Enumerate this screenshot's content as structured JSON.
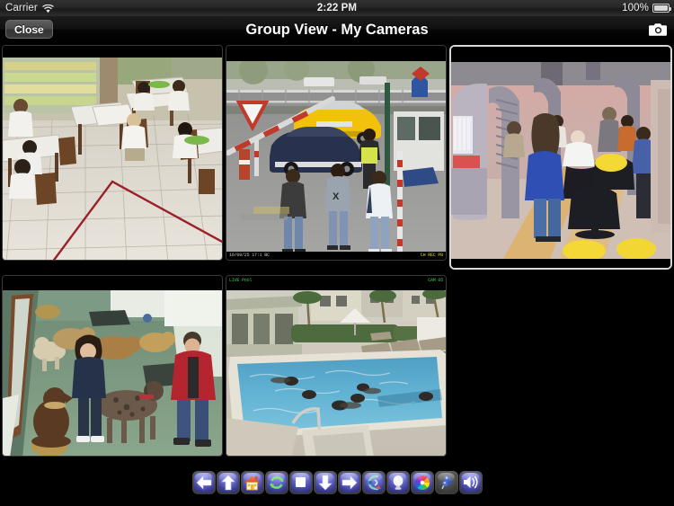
{
  "statusbar": {
    "carrier": "Carrier",
    "wifi_icon": "wifi-icon",
    "time": "2:22 PM",
    "battery_percent": "100%",
    "battery_icon": "battery-full-icon"
  },
  "titlebar": {
    "close_label": "Close",
    "title": "Group View - My Cameras",
    "camera_icon": "camera-icon"
  },
  "grid": {
    "tiles": [
      {
        "id": "tile-1",
        "name": "camera-tile-1",
        "scene": "classroom-cafeteria",
        "selected": false,
        "osd_bottom_left": "",
        "osd_bottom_right": ""
      },
      {
        "id": "tile-2",
        "name": "camera-tile-2",
        "scene": "parking-gate-entrance",
        "selected": false,
        "osd_bottom_left": "10/09/25  17:1  BC",
        "osd_bottom_right": "CH  REC  PB"
      },
      {
        "id": "tile-3",
        "name": "camera-tile-3",
        "scene": "hair-salon-interior",
        "selected": true,
        "osd_bottom_left": "",
        "osd_bottom_right": ""
      },
      {
        "id": "tile-4",
        "name": "camera-tile-4",
        "scene": "dog-daycare",
        "selected": false,
        "osd_bottom_left": "",
        "osd_bottom_right": ""
      },
      {
        "id": "tile-5",
        "name": "camera-tile-5",
        "scene": "swimming-pool",
        "selected": false,
        "osd_top_left": "LIVE  Pool",
        "osd_top_right": "CAM 05"
      }
    ]
  },
  "toolbar": {
    "buttons": [
      {
        "name": "pan-left-button",
        "icon": "arrow-left-icon",
        "label": "Pan Left"
      },
      {
        "name": "tilt-up-button",
        "icon": "arrow-up-icon",
        "label": "Tilt Up"
      },
      {
        "name": "home-preset-button",
        "icon": "home-icon",
        "label": "Home"
      },
      {
        "name": "auto-scan-button",
        "icon": "refresh-icon",
        "label": "Auto Scan"
      },
      {
        "name": "stop-button",
        "icon": "stop-square-icon",
        "label": "Stop"
      },
      {
        "name": "tilt-down-button",
        "icon": "arrow-down-icon",
        "label": "Tilt Down"
      },
      {
        "name": "pan-right-button",
        "icon": "arrow-right-icon",
        "label": "Pan Right"
      },
      {
        "name": "pattern-tour-button",
        "icon": "pattern-path-icon",
        "label": "Pattern Tour"
      },
      {
        "name": "light-control-button",
        "icon": "lamp-icon",
        "label": "Light"
      },
      {
        "name": "color-settings-button",
        "icon": "color-wheel-icon",
        "label": "Color"
      },
      {
        "name": "wiper-button",
        "icon": "wiper-icon",
        "label": "Wiper"
      },
      {
        "name": "audio-button",
        "icon": "speaker-icon",
        "label": "Audio"
      }
    ]
  },
  "colors": {
    "accent_blue": "#5a5cc2",
    "bar_black": "#000000",
    "status_gray": "#2b2b2b",
    "selection_border": "#d7d7d7"
  }
}
